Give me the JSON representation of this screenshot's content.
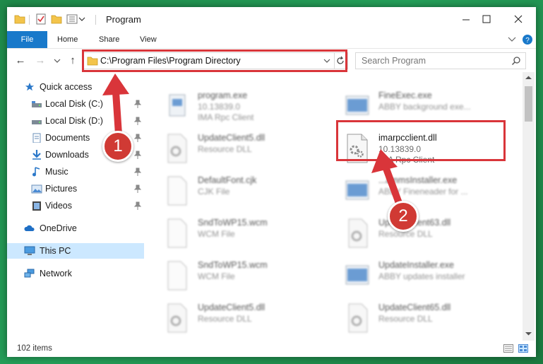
{
  "window": {
    "title": "Program"
  },
  "ribbon": {
    "tabs": [
      "File",
      "Home",
      "Share",
      "View"
    ]
  },
  "address": {
    "path": "C:\\Program Files\\Program Directory",
    "search_placeholder": "Search Program"
  },
  "nav": {
    "quick_access": "Quick access",
    "pinned": [
      {
        "label": "Local Disk (C:)",
        "icon": "drive-icon"
      },
      {
        "label": "Local Disk (D:)",
        "icon": "drive-icon"
      },
      {
        "label": "Documents",
        "icon": "documents-icon"
      },
      {
        "label": "Downloads",
        "icon": "downloads-icon"
      },
      {
        "label": "Music",
        "icon": "music-icon"
      },
      {
        "label": "Pictures",
        "icon": "pictures-icon"
      },
      {
        "label": "Videos",
        "icon": "videos-icon"
      }
    ],
    "onedrive": "OneDrive",
    "this_pc": "This PC",
    "network": "Network"
  },
  "files": {
    "left": [
      {
        "name": "program.exe",
        "l2": "10.13839.0",
        "l3": "IMA Rpc Client"
      },
      {
        "name": "UpdateClient5.dll",
        "l2": "Resource DLL",
        "l3": ""
      },
      {
        "name": "DefaultFont.cjk",
        "l2": "CJK File",
        "l3": ""
      },
      {
        "name": "SndToWP15.wcm",
        "l2": "WCM File",
        "l3": ""
      },
      {
        "name": "SndToWP15.wcm",
        "l2": "WCM File",
        "l3": ""
      },
      {
        "name": "UpdateClient5.dll",
        "l2": "Resource DLL",
        "l3": ""
      }
    ],
    "right": [
      {
        "name": "FineExec.exe",
        "l2": "ABBY background exe...",
        "l3": ""
      },
      {
        "name": "imarpcclient.dll",
        "l2": "10.13839.0",
        "l3": "IMA Rpc Client"
      },
      {
        "name": "...ammsInstaller.exe",
        "l2": "ABBY Fineneader for ...",
        "l3": ""
      },
      {
        "name": "UpdateClient63.dll",
        "l2": "Resource DLL",
        "l3": ""
      },
      {
        "name": "UpdateInstaller.exe",
        "l2": "ABBY updates installer",
        "l3": ""
      },
      {
        "name": "UpdateClient65.dll",
        "l2": "Resource DLL",
        "l3": ""
      }
    ]
  },
  "status": {
    "items": "102 items"
  },
  "annotations": {
    "step1": "1",
    "step2": "2"
  },
  "colors": {
    "accent": "#1979ca",
    "highlight": "#d9353a",
    "selection": "#cce8ff"
  }
}
